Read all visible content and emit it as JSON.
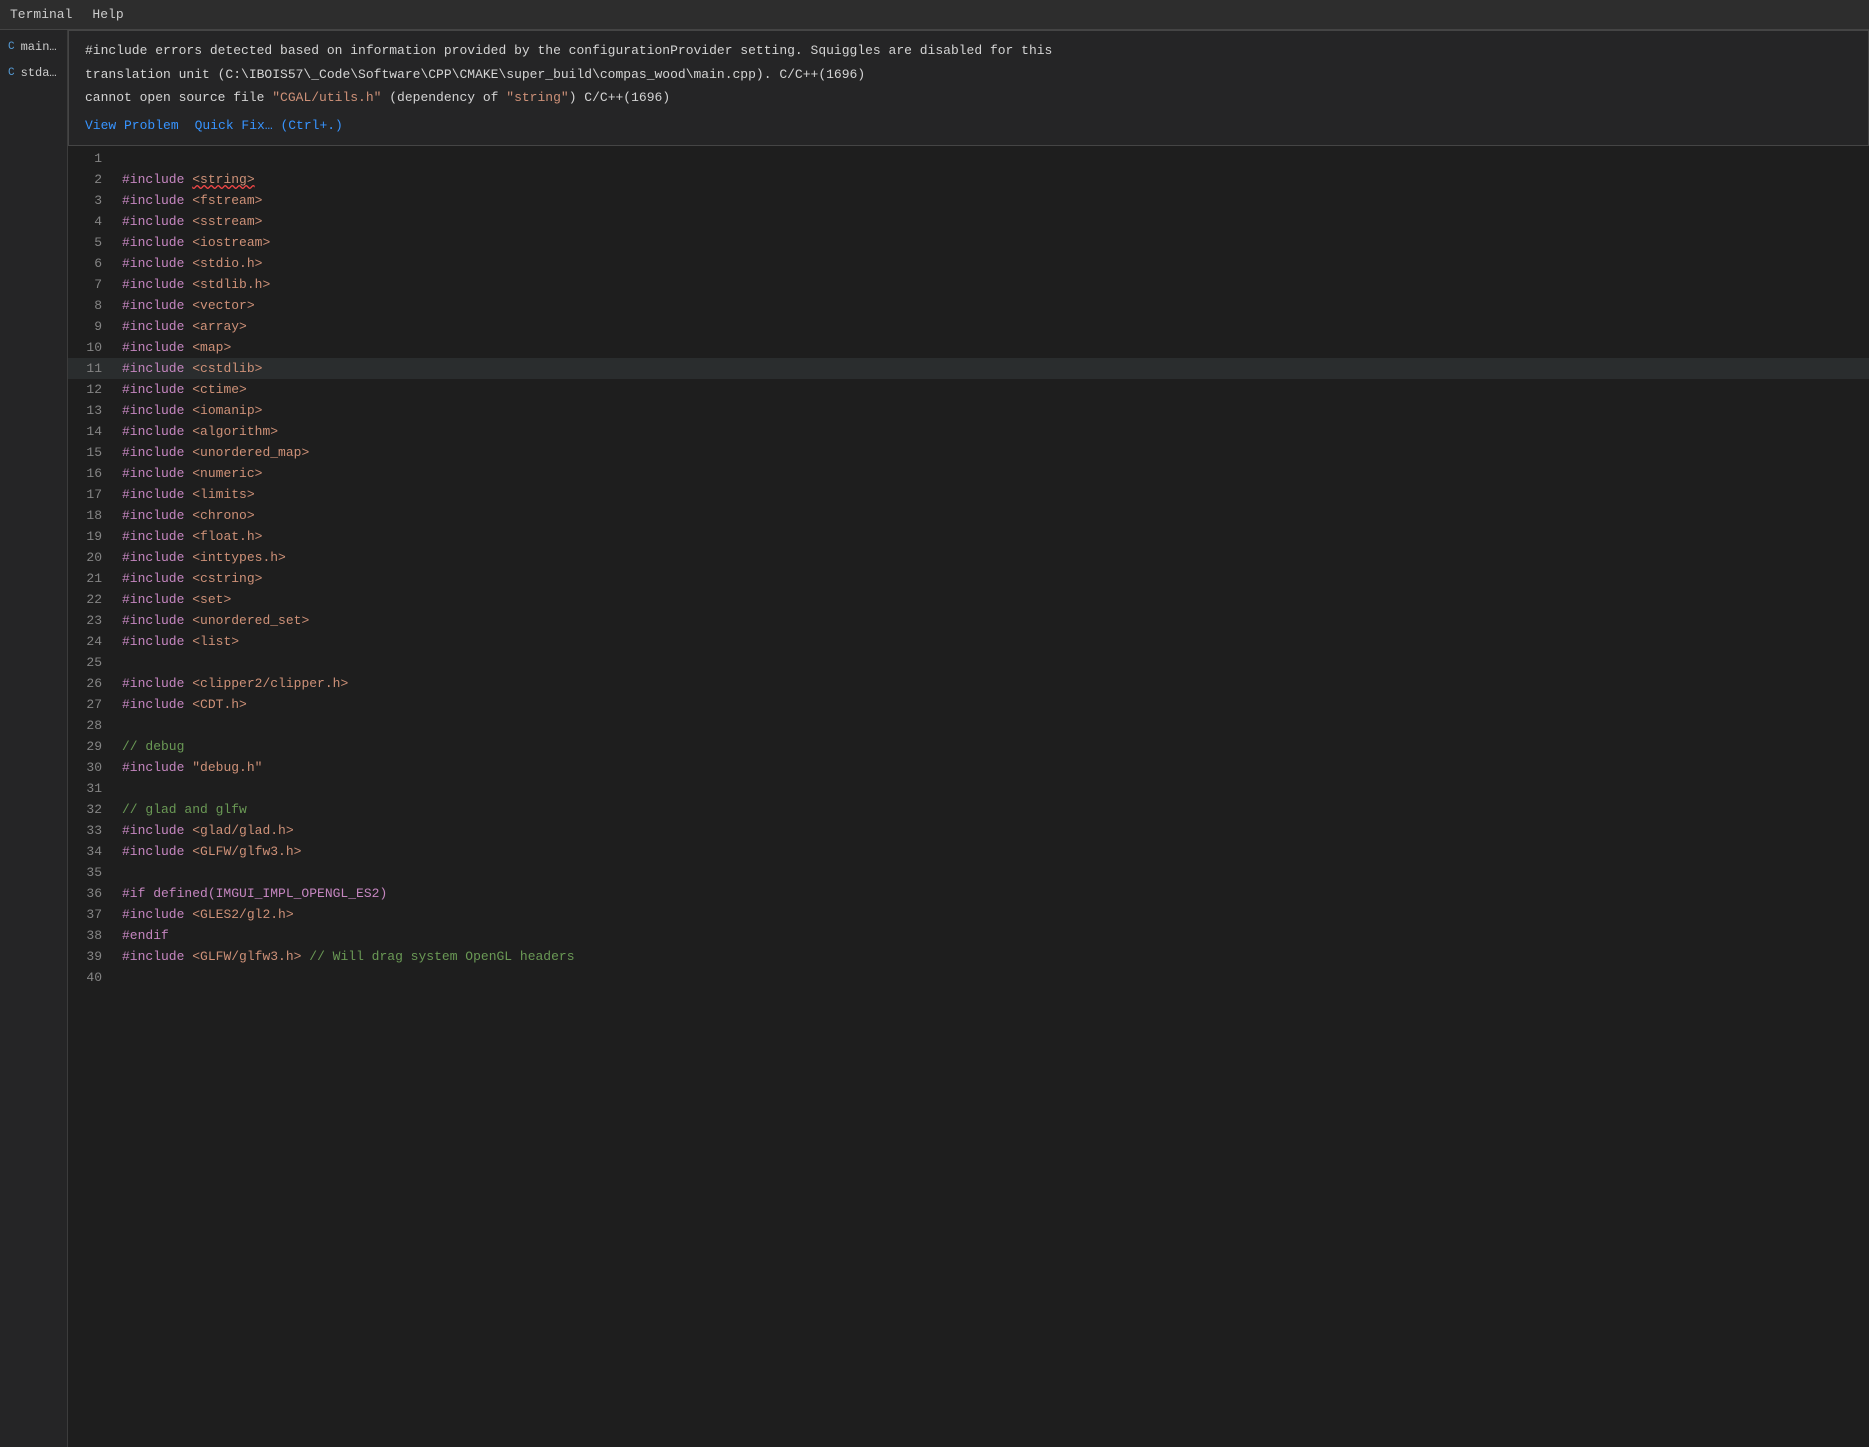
{
  "topbar": {
    "items": [
      "Terminal",
      "Help"
    ]
  },
  "sidebar": {
    "files": [
      {
        "icon": "C++",
        "name": "main.c",
        "type": "cpp"
      },
      {
        "icon": "C",
        "name": "stdaf...",
        "type": "c"
      }
    ]
  },
  "tooltip": {
    "line1": "#include errors detected based on information provided by the configurationProvider setting. Squiggles are disabled for this",
    "line2": "translation unit (C:\\IBOIS57\\_Code\\Software\\CPP\\CMAKE\\super_build\\compas_wood\\main.cpp). C/C++(1696)",
    "line3_pre": "cannot open source file ",
    "line3_file": "\"CGAL/utils.h\"",
    "line3_post": " (dependency of ",
    "line3_dep": "\"string\"",
    "line3_close": ") C/C++(1696)",
    "action1": "View Problem",
    "action2": "Quick Fix… (Ctrl+.)"
  },
  "code": {
    "lines": [
      {
        "num": 1,
        "content": "",
        "tokens": []
      },
      {
        "num": 2,
        "content": "#include <string>",
        "tokens": [
          {
            "type": "preprocessor",
            "text": "#include"
          },
          {
            "type": "space",
            "text": " "
          },
          {
            "type": "include-bracket",
            "text": "<string>",
            "squiggle": true
          }
        ]
      },
      {
        "num": 3,
        "content": "#include <fstream>",
        "tokens": [
          {
            "type": "preprocessor",
            "text": "#include"
          },
          {
            "type": "space",
            "text": " "
          },
          {
            "type": "include-bracket",
            "text": "<fstream>"
          }
        ]
      },
      {
        "num": 4,
        "content": "#include <sstream>",
        "tokens": [
          {
            "type": "preprocessor",
            "text": "#include"
          },
          {
            "type": "space",
            "text": " "
          },
          {
            "type": "include-bracket",
            "text": "<sstream>"
          }
        ]
      },
      {
        "num": 5,
        "content": "#include <iostream>",
        "tokens": [
          {
            "type": "preprocessor",
            "text": "#include"
          },
          {
            "type": "space",
            "text": " "
          },
          {
            "type": "include-bracket",
            "text": "<iostream>"
          }
        ]
      },
      {
        "num": 6,
        "content": "#include <stdio.h>",
        "tokens": [
          {
            "type": "preprocessor",
            "text": "#include"
          },
          {
            "type": "space",
            "text": " "
          },
          {
            "type": "include-bracket",
            "text": "<stdio.h>"
          }
        ]
      },
      {
        "num": 7,
        "content": "#include <stdlib.h>",
        "tokens": [
          {
            "type": "preprocessor",
            "text": "#include"
          },
          {
            "type": "space",
            "text": " "
          },
          {
            "type": "include-bracket",
            "text": "<stdlib.h>"
          }
        ]
      },
      {
        "num": 8,
        "content": "#include <vector>",
        "tokens": [
          {
            "type": "preprocessor",
            "text": "#include"
          },
          {
            "type": "space",
            "text": " "
          },
          {
            "type": "include-bracket",
            "text": "<vector>"
          }
        ]
      },
      {
        "num": 9,
        "content": "#include <array>",
        "tokens": [
          {
            "type": "preprocessor",
            "text": "#include"
          },
          {
            "type": "space",
            "text": " "
          },
          {
            "type": "include-bracket",
            "text": "<array>"
          }
        ]
      },
      {
        "num": 10,
        "content": "#include <map>",
        "tokens": [
          {
            "type": "preprocessor",
            "text": "#include"
          },
          {
            "type": "space",
            "text": " "
          },
          {
            "type": "include-bracket",
            "text": "<map>"
          }
        ]
      },
      {
        "num": 11,
        "content": "#include <cstdlib>",
        "tokens": [
          {
            "type": "preprocessor",
            "text": "#include"
          },
          {
            "type": "space",
            "text": " "
          },
          {
            "type": "include-bracket",
            "text": "<cstdlib>"
          }
        ],
        "highlighted": true
      },
      {
        "num": 12,
        "content": "#include <ctime>",
        "tokens": [
          {
            "type": "preprocessor",
            "text": "#include"
          },
          {
            "type": "space",
            "text": " "
          },
          {
            "type": "include-bracket",
            "text": "<ctime>"
          }
        ]
      },
      {
        "num": 13,
        "content": "#include <iomanip>",
        "tokens": [
          {
            "type": "preprocessor",
            "text": "#include"
          },
          {
            "type": "space",
            "text": " "
          },
          {
            "type": "include-bracket",
            "text": "<iomanip>"
          }
        ]
      },
      {
        "num": 14,
        "content": "#include <algorithm>",
        "tokens": [
          {
            "type": "preprocessor",
            "text": "#include"
          },
          {
            "type": "space",
            "text": " "
          },
          {
            "type": "include-bracket",
            "text": "<algorithm>"
          }
        ]
      },
      {
        "num": 15,
        "content": "#include <unordered_map>",
        "tokens": [
          {
            "type": "preprocessor",
            "text": "#include"
          },
          {
            "type": "space",
            "text": " "
          },
          {
            "type": "include-bracket",
            "text": "<unordered_map>"
          }
        ]
      },
      {
        "num": 16,
        "content": "#include <numeric>",
        "tokens": [
          {
            "type": "preprocessor",
            "text": "#include"
          },
          {
            "type": "space",
            "text": " "
          },
          {
            "type": "include-bracket",
            "text": "<numeric>"
          }
        ]
      },
      {
        "num": 17,
        "content": "#include <limits>",
        "tokens": [
          {
            "type": "preprocessor",
            "text": "#include"
          },
          {
            "type": "space",
            "text": " "
          },
          {
            "type": "include-bracket",
            "text": "<limits>"
          }
        ]
      },
      {
        "num": 18,
        "content": "#include <chrono>",
        "tokens": [
          {
            "type": "preprocessor",
            "text": "#include"
          },
          {
            "type": "space",
            "text": " "
          },
          {
            "type": "include-bracket",
            "text": "<chrono>"
          }
        ]
      },
      {
        "num": 19,
        "content": "#include <float.h>",
        "tokens": [
          {
            "type": "preprocessor",
            "text": "#include"
          },
          {
            "type": "space",
            "text": " "
          },
          {
            "type": "include-bracket",
            "text": "<float.h>"
          }
        ]
      },
      {
        "num": 20,
        "content": "#include <inttypes.h>",
        "tokens": [
          {
            "type": "preprocessor",
            "text": "#include"
          },
          {
            "type": "space",
            "text": " "
          },
          {
            "type": "include-bracket",
            "text": "<inttypes.h>"
          }
        ]
      },
      {
        "num": 21,
        "content": "#include <cstring>",
        "tokens": [
          {
            "type": "preprocessor",
            "text": "#include"
          },
          {
            "type": "space",
            "text": " "
          },
          {
            "type": "include-bracket",
            "text": "<cstring>"
          }
        ]
      },
      {
        "num": 22,
        "content": "#include <set>",
        "tokens": [
          {
            "type": "preprocessor",
            "text": "#include"
          },
          {
            "type": "space",
            "text": " "
          },
          {
            "type": "include-bracket",
            "text": "<set>"
          }
        ]
      },
      {
        "num": 23,
        "content": "#include <unordered_set>",
        "tokens": [
          {
            "type": "preprocessor",
            "text": "#include"
          },
          {
            "type": "space",
            "text": " "
          },
          {
            "type": "include-bracket",
            "text": "<unordered_set>"
          }
        ]
      },
      {
        "num": 24,
        "content": "#include <list>",
        "tokens": [
          {
            "type": "preprocessor",
            "text": "#include"
          },
          {
            "type": "space",
            "text": " "
          },
          {
            "type": "include-bracket",
            "text": "<list>"
          }
        ]
      },
      {
        "num": 25,
        "content": "",
        "tokens": []
      },
      {
        "num": 26,
        "content": "#include <clipper2/clipper.h>",
        "tokens": [
          {
            "type": "preprocessor",
            "text": "#include"
          },
          {
            "type": "space",
            "text": " "
          },
          {
            "type": "include-bracket",
            "text": "<clipper2/clipper.h>"
          }
        ]
      },
      {
        "num": 27,
        "content": "#include <CDT.h>",
        "tokens": [
          {
            "type": "preprocessor",
            "text": "#include"
          },
          {
            "type": "space",
            "text": " "
          },
          {
            "type": "include-bracket",
            "text": "<CDT.h>"
          }
        ]
      },
      {
        "num": 28,
        "content": "",
        "tokens": []
      },
      {
        "num": 29,
        "content": "// debug",
        "tokens": [
          {
            "type": "comment",
            "text": "// debug"
          }
        ]
      },
      {
        "num": 30,
        "content": "#include \"debug.h\"",
        "tokens": [
          {
            "type": "preprocessor",
            "text": "#include"
          },
          {
            "type": "space",
            "text": " "
          },
          {
            "type": "string",
            "text": "\"debug.h\""
          }
        ]
      },
      {
        "num": 31,
        "content": "",
        "tokens": []
      },
      {
        "num": 32,
        "content": "// glad and glfw",
        "tokens": [
          {
            "type": "comment",
            "text": "// glad and glfw"
          }
        ]
      },
      {
        "num": 33,
        "content": "#include <glad/glad.h>",
        "tokens": [
          {
            "type": "preprocessor",
            "text": "#include"
          },
          {
            "type": "space",
            "text": " "
          },
          {
            "type": "include-bracket",
            "text": "<glad/glad.h>"
          }
        ]
      },
      {
        "num": 34,
        "content": "#include <GLFW/glfw3.h>",
        "tokens": [
          {
            "type": "preprocessor",
            "text": "#include"
          },
          {
            "type": "space",
            "text": " "
          },
          {
            "type": "include-bracket",
            "text": "<GLFW/glfw3.h>"
          }
        ]
      },
      {
        "num": 35,
        "content": "",
        "tokens": []
      },
      {
        "num": 36,
        "content": "#if defined(IMGUI_IMPL_OPENGL_ES2)",
        "tokens": [
          {
            "type": "preprocessor",
            "text": "#if defined(IMGUI_IMPL_OPENGL_ES2)"
          }
        ]
      },
      {
        "num": 37,
        "content": "#include <GLES2/gl2.h>",
        "tokens": [
          {
            "type": "preprocessor",
            "text": "#include"
          },
          {
            "type": "space",
            "text": " "
          },
          {
            "type": "include-bracket",
            "text": "<GLES2/gl2.h>"
          }
        ]
      },
      {
        "num": 38,
        "content": "#endif",
        "tokens": [
          {
            "type": "preprocessor",
            "text": "#endif"
          }
        ]
      },
      {
        "num": 39,
        "content": "#include <GLFW/glfw3.h> // Will drag system OpenGL headers",
        "tokens": [
          {
            "type": "preprocessor",
            "text": "#include"
          },
          {
            "type": "space",
            "text": " "
          },
          {
            "type": "include-bracket",
            "text": "<GLFW/glfw3.h>"
          },
          {
            "type": "space",
            "text": " "
          },
          {
            "type": "comment",
            "text": "// Will drag system OpenGL headers"
          }
        ]
      },
      {
        "num": 40,
        "content": "",
        "tokens": []
      }
    ]
  }
}
